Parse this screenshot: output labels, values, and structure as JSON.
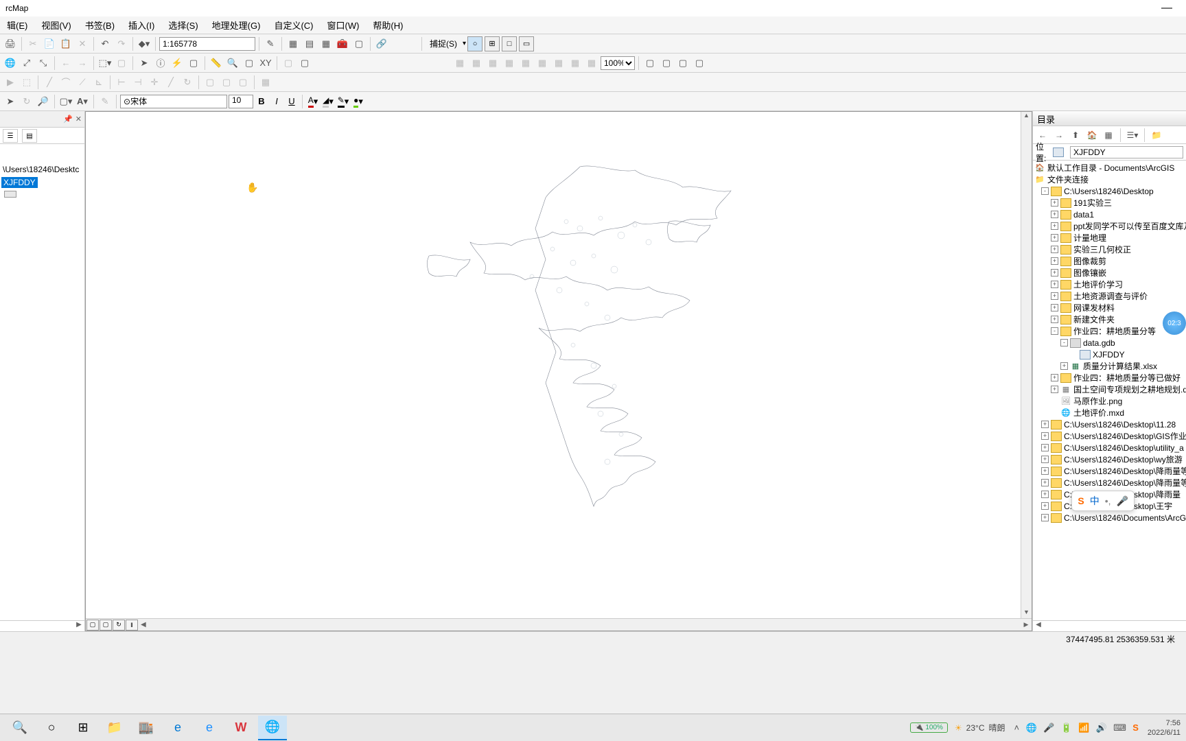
{
  "title_bar": {
    "app": "rcMap"
  },
  "menu": [
    "辑(E)",
    "视图(V)",
    "书签(B)",
    "插入(I)",
    "选择(S)",
    "地理处理(G)",
    "自定义(C)",
    "窗口(W)",
    "帮助(H)"
  ],
  "toolbar1": {
    "scale_value": "1:165778",
    "snap_label": "捕捉(S)"
  },
  "toolbar2": {
    "zoom_value": "100%"
  },
  "toolbar_text": {
    "font_name": "宋体",
    "font_size": "10"
  },
  "toc": {
    "root_path": "\\Users\\18246\\Desktc",
    "layer_name": "XJFDDY"
  },
  "catalog": {
    "title": "目录",
    "location_label": "位置:",
    "location_value": "XJFDDY",
    "tree": {
      "default_root": "默认工作目录 - Documents\\ArcGIS",
      "folder_conn": "文件夹连接",
      "desktop": "C:\\Users\\18246\\Desktop",
      "items": [
        "191实验三",
        "data1",
        "ppt发同学不可以传至百度文库及",
        "计量地理",
        "实验三几何校正",
        "图像裁剪",
        "图像镶嵌",
        "土地评价学习",
        "土地资源调查与评价",
        "网课发材料",
        "新建文件夹",
        "作业四：耕地质量分等"
      ],
      "gdb": "data.gdb",
      "fc": "XJFDDY",
      "xls": "质量分计算结果.xlsx",
      "job4b": "作业四：耕地质量分等已做好",
      "dwg": "国土空间专项规划之耕地规划.dv",
      "png": "马原作业.png",
      "mxd": "土地评价.mxd",
      "conns": [
        "C:\\Users\\18246\\Desktop\\11.28",
        "C:\\Users\\18246\\Desktop\\GIS作业",
        "C:\\Users\\18246\\Desktop\\utility_a",
        "C:\\Users\\18246\\Desktop\\wy旅游",
        "C:\\Users\\18246\\Desktop\\降雨量等",
        "C:\\Users\\18246\\Desktop\\降雨量等",
        "C:\\Users\\18246\\Desktop\\降雨量",
        "C:\\Users\\18246\\Desktop\\王宇",
        "C:\\Users\\18246\\Documents\\ArcG"
      ]
    }
  },
  "status": {
    "coords": "37447495.81 2536359.531 米"
  },
  "ime": {
    "zh": "中"
  },
  "timer": {
    "value": "02:3"
  },
  "taskbar": {
    "weather_temp": "23°C",
    "weather_desc": "晴朗",
    "battery": "100%",
    "time": "7:56",
    "date": "2022/6/11"
  }
}
